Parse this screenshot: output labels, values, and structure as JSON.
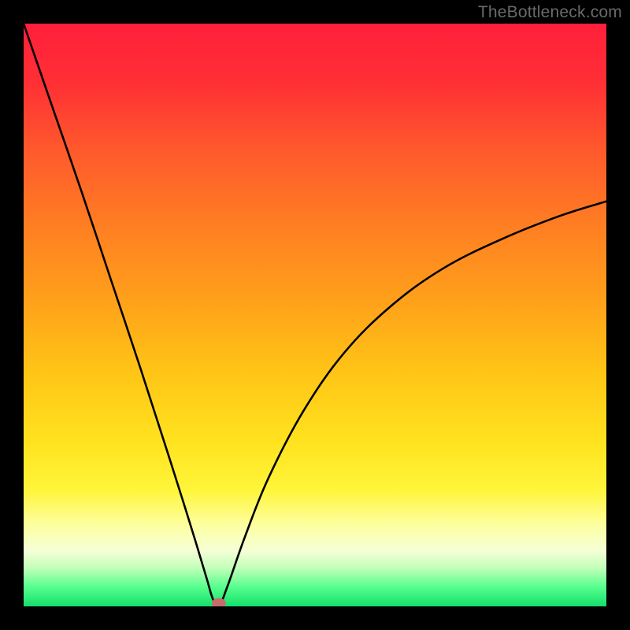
{
  "watermark": "TheBottleneck.com",
  "colors": {
    "background": "#000000",
    "gradient_stops": [
      {
        "offset": 0.0,
        "color": "#ff1f3a"
      },
      {
        "offset": 0.1,
        "color": "#ff2f35"
      },
      {
        "offset": 0.22,
        "color": "#ff5a2c"
      },
      {
        "offset": 0.35,
        "color": "#ff7f22"
      },
      {
        "offset": 0.48,
        "color": "#ffa21a"
      },
      {
        "offset": 0.6,
        "color": "#ffc516"
      },
      {
        "offset": 0.72,
        "color": "#ffe31f"
      },
      {
        "offset": 0.8,
        "color": "#fff53a"
      },
      {
        "offset": 0.86,
        "color": "#fdffa0"
      },
      {
        "offset": 0.905,
        "color": "#f5ffd6"
      },
      {
        "offset": 0.935,
        "color": "#c0ffb8"
      },
      {
        "offset": 0.965,
        "color": "#5cff90"
      },
      {
        "offset": 1.0,
        "color": "#12e06a"
      }
    ],
    "curve": "#000000",
    "marker_fill": "#c76b6b",
    "marker_stroke": "#8c4a4a"
  },
  "chart_data": {
    "type": "line",
    "title": "",
    "xlabel": "",
    "ylabel": "",
    "xlim": [
      0,
      100
    ],
    "ylim": [
      0,
      100
    ],
    "series": [
      {
        "name": "bottleneck-curve",
        "x": [
          0,
          5,
          10,
          15,
          20,
          25,
          28,
          30,
          31.5,
          32.5,
          33.5,
          35,
          38,
          42,
          48,
          55,
          63,
          72,
          82,
          92,
          100
        ],
        "y": [
          100,
          85.5,
          71,
          56,
          41,
          25.5,
          16,
          9.5,
          4.5,
          1.2,
          0,
          3.5,
          12,
          22,
          33.5,
          43.5,
          51.5,
          58,
          63,
          67,
          69.5
        ]
      }
    ],
    "annotations": [
      {
        "name": "minimum-marker",
        "x": 33.5,
        "y": 0
      }
    ]
  }
}
